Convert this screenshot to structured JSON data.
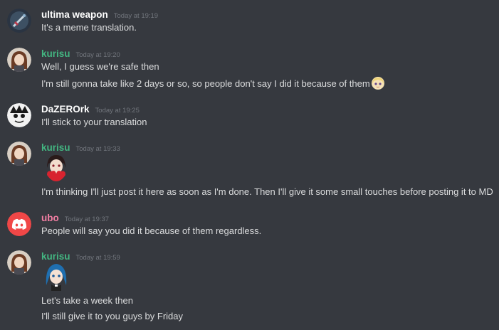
{
  "colors": {
    "background": "#36393f",
    "text": "#dcddde",
    "timestamp": "#72767d",
    "kurisu": "#43b581",
    "default_user": "#ffffff",
    "ubo": "#f47fa4",
    "discord_blurple": "#f04747"
  },
  "messages": [
    {
      "author": "ultima weapon",
      "timestamp": "Today at 19:19",
      "avatar": "sword-avatar-icon",
      "lines": [
        "It's a meme translation."
      ]
    },
    {
      "author": "kurisu",
      "timestamp": "Today at 19:20",
      "avatar": "anime-girl-avatar-icon",
      "lines": [
        "Well, I guess we're safe then",
        "I'm still gonna take like 2 days or so, so people don't say I did it because of them"
      ],
      "inline_emoji": "blonde-anime-girl-emoji"
    },
    {
      "author": "DaZEROrk",
      "timestamp": "Today at 19:25",
      "avatar": "manga-face-avatar-icon",
      "lines": [
        "I'll stick to your translation"
      ]
    },
    {
      "author": "kurisu",
      "timestamp": "Today at 19:33",
      "avatar": "anime-girl-avatar-icon",
      "sticker": "heart-anime-girl-sticker",
      "lines": [
        "I'm thinking I'll just post it here as soon as I'm done. Then I'll give it some small touches before posting it to MD"
      ]
    },
    {
      "author": "ubo",
      "timestamp": "Today at 19:37",
      "avatar": "discord-logo-avatar-icon",
      "lines": [
        "People will say you did it because of them regardless."
      ]
    },
    {
      "author": "kurisu",
      "timestamp": "Today at 19:59",
      "avatar": "anime-girl-avatar-icon",
      "sticker": "blue-hair-anime-girl-sticker",
      "lines": [
        "Let's take a week then",
        "I'll still give it to you guys by Friday"
      ]
    }
  ]
}
